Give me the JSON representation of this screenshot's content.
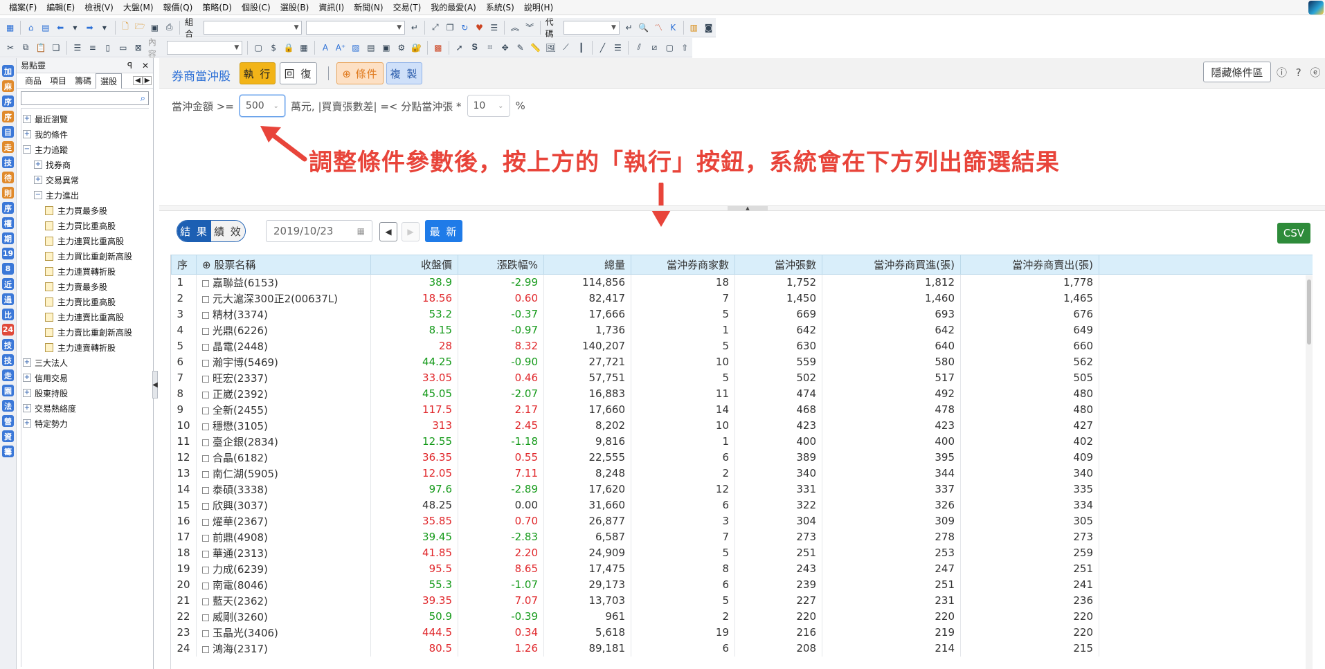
{
  "menu": [
    "檔案(F)",
    "編輯(E)",
    "檢視(V)",
    "大盤(M)",
    "報價(Q)",
    "策略(D)",
    "個股(C)",
    "選股(B)",
    "資訊(I)",
    "新聞(N)",
    "交易(T)",
    "我的最愛(A)",
    "系統(S)",
    "說明(H)"
  ],
  "toolbar": {
    "combo_label": "組合",
    "code_label": "代碼",
    "content_label": "內容"
  },
  "icon_strip": [
    {
      "text": "加",
      "color": "#3b78d8"
    },
    {
      "text": "麻",
      "color": "#e08a2c"
    },
    {
      "text": "序",
      "color": "#3b78d8"
    },
    {
      "text": "序",
      "color": "#e08a2c"
    },
    {
      "text": "目",
      "color": "#3b78d8"
    },
    {
      "text": "走",
      "color": "#e08a2c"
    },
    {
      "text": "技",
      "color": "#3b78d8"
    },
    {
      "text": "待",
      "color": "#e08a2c"
    },
    {
      "text": "則",
      "color": "#e08a2c"
    },
    {
      "text": "序",
      "color": "#3b78d8"
    },
    {
      "text": "權",
      "color": "#3b78d8"
    },
    {
      "text": "期",
      "color": "#3b78d8"
    },
    {
      "text": "19",
      "color": "#3b78d8"
    },
    {
      "text": "8",
      "color": "#3b78d8"
    },
    {
      "text": "近",
      "color": "#3b78d8"
    },
    {
      "text": "過",
      "color": "#3b78d8"
    },
    {
      "text": "比",
      "color": "#3b78d8"
    },
    {
      "text": "24",
      "color": "#e04a3a"
    },
    {
      "text": "技",
      "color": "#3b78d8"
    },
    {
      "text": "技",
      "color": "#3b78d8"
    },
    {
      "text": "走",
      "color": "#3b78d8"
    },
    {
      "text": "園",
      "color": "#3b78d8"
    },
    {
      "text": "法",
      "color": "#3b78d8"
    },
    {
      "text": "營",
      "color": "#3b78d8"
    },
    {
      "text": "資",
      "color": "#3b78d8"
    },
    {
      "text": "籌",
      "color": "#3b78d8"
    }
  ],
  "easy_panel": {
    "title": "易點靈",
    "pin": "ꟼ",
    "close": "✕",
    "tabs": [
      "商品",
      "項目",
      "籌碼",
      "選股"
    ],
    "active_tab": "選股",
    "tree": [
      {
        "label": "最近瀏覽",
        "box": "+",
        "level": 0
      },
      {
        "label": "我的條件",
        "box": "+",
        "level": 0
      },
      {
        "label": "主力追蹤",
        "box": "−",
        "level": 0
      },
      {
        "label": "找券商",
        "box": "+",
        "level": 1
      },
      {
        "label": "交易異常",
        "box": "+",
        "level": 1
      },
      {
        "label": "主力進出",
        "box": "−",
        "level": 1
      },
      {
        "label": "主力買最多股",
        "doc": true,
        "level": 2
      },
      {
        "label": "主力買比重高股",
        "doc": true,
        "level": 2
      },
      {
        "label": "主力連買比重高股",
        "doc": true,
        "level": 2
      },
      {
        "label": "主力買比重創新高股",
        "doc": true,
        "level": 2
      },
      {
        "label": "主力連買轉折股",
        "doc": true,
        "level": 2
      },
      {
        "label": "主力賣最多股",
        "doc": true,
        "level": 2
      },
      {
        "label": "主力賣比重高股",
        "doc": true,
        "level": 2
      },
      {
        "label": "主力連賣比重高股",
        "doc": true,
        "level": 2
      },
      {
        "label": "主力賣比重創新高股",
        "doc": true,
        "level": 2
      },
      {
        "label": "主力連賣轉折股",
        "doc": true,
        "level": 2
      },
      {
        "label": "三大法人",
        "box": "+",
        "level": 0
      },
      {
        "label": "信用交易",
        "box": "+",
        "level": 0
      },
      {
        "label": "股東持股",
        "box": "+",
        "level": 0
      },
      {
        "label": "交易熱絡度",
        "box": "+",
        "level": 0
      },
      {
        "label": "特定勢力",
        "box": "+",
        "level": 0
      }
    ]
  },
  "header": {
    "title": "券商當沖股",
    "run": "執 行",
    "reset": "回 復",
    "condition": "⊕ 條件",
    "copy": "複 製",
    "hide": "隱藏條件區",
    "icons": "ⓘ ⓘ ⓔ"
  },
  "condition": {
    "prefix": "當沖金額 >=",
    "amount": "500",
    "middle": "萬元, |買賣張數差| =< 分點當沖張 *",
    "ratio": "10",
    "suffix": "%"
  },
  "annotation": "調整條件參數後，按上方的「執行」按鈕，系統會在下方列出篩選結果",
  "results": {
    "tab_result": "結 果",
    "tab_perf": "績 效",
    "date": "2019/10/23",
    "latest": "最 新",
    "csv": "CSV"
  },
  "table": {
    "columns": [
      "序",
      "⊕ 股票名稱",
      "收盤價",
      "漲跌幅%",
      "總量",
      "當沖券商家數",
      "當沖張數",
      "當沖券商買進(張)",
      "當沖券商賣出(張)"
    ],
    "rows": [
      {
        "n": "1",
        "name": "嘉聯益(6153)",
        "close": "38.9",
        "chg": "-2.99",
        "vol": "114,856",
        "brokers": "18",
        "dt": "1,752",
        "buy": "1,812",
        "sell": "1,778",
        "dir": "down"
      },
      {
        "n": "2",
        "name": "元大滬深300正2(00637L)",
        "close": "18.56",
        "chg": "0.60",
        "vol": "82,417",
        "brokers": "7",
        "dt": "1,450",
        "buy": "1,460",
        "sell": "1,465",
        "dir": "up"
      },
      {
        "n": "3",
        "name": "精材(3374)",
        "close": "53.2",
        "chg": "-0.37",
        "vol": "17,666",
        "brokers": "5",
        "dt": "669",
        "buy": "693",
        "sell": "676",
        "dir": "down"
      },
      {
        "n": "4",
        "name": "光鼎(6226)",
        "close": "8.15",
        "chg": "-0.97",
        "vol": "1,736",
        "brokers": "1",
        "dt": "642",
        "buy": "642",
        "sell": "649",
        "dir": "down"
      },
      {
        "n": "5",
        "name": "晶電(2448)",
        "close": "28",
        "chg": "8.32",
        "vol": "140,207",
        "brokers": "5",
        "dt": "630",
        "buy": "640",
        "sell": "660",
        "dir": "up"
      },
      {
        "n": "6",
        "name": "瀚宇博(5469)",
        "close": "44.25",
        "chg": "-0.90",
        "vol": "27,721",
        "brokers": "10",
        "dt": "559",
        "buy": "580",
        "sell": "562",
        "dir": "down"
      },
      {
        "n": "7",
        "name": "旺宏(2337)",
        "close": "33.05",
        "chg": "0.46",
        "vol": "57,751",
        "brokers": "5",
        "dt": "502",
        "buy": "517",
        "sell": "505",
        "dir": "up"
      },
      {
        "n": "8",
        "name": "正崴(2392)",
        "close": "45.05",
        "chg": "-2.07",
        "vol": "16,883",
        "brokers": "11",
        "dt": "474",
        "buy": "492",
        "sell": "480",
        "dir": "down"
      },
      {
        "n": "9",
        "name": "全新(2455)",
        "close": "117.5",
        "chg": "2.17",
        "vol": "17,660",
        "brokers": "14",
        "dt": "468",
        "buy": "478",
        "sell": "480",
        "dir": "up"
      },
      {
        "n": "10",
        "name": "穩懋(3105)",
        "close": "313",
        "chg": "2.45",
        "vol": "8,202",
        "brokers": "10",
        "dt": "423",
        "buy": "423",
        "sell": "427",
        "dir": "up"
      },
      {
        "n": "11",
        "name": "臺企銀(2834)",
        "close": "12.55",
        "chg": "-1.18",
        "vol": "9,816",
        "brokers": "1",
        "dt": "400",
        "buy": "400",
        "sell": "402",
        "dir": "down"
      },
      {
        "n": "12",
        "name": "合晶(6182)",
        "close": "36.35",
        "chg": "0.55",
        "vol": "22,555",
        "brokers": "6",
        "dt": "389",
        "buy": "395",
        "sell": "409",
        "dir": "up"
      },
      {
        "n": "13",
        "name": "南仁湖(5905)",
        "close": "12.05",
        "chg": "7.11",
        "vol": "8,248",
        "brokers": "2",
        "dt": "340",
        "buy": "344",
        "sell": "340",
        "dir": "up"
      },
      {
        "n": "14",
        "name": "泰碩(3338)",
        "close": "97.6",
        "chg": "-2.89",
        "vol": "17,620",
        "brokers": "12",
        "dt": "331",
        "buy": "337",
        "sell": "335",
        "dir": "down"
      },
      {
        "n": "15",
        "name": "欣興(3037)",
        "close": "48.25",
        "chg": "0.00",
        "vol": "31,660",
        "brokers": "6",
        "dt": "322",
        "buy": "326",
        "sell": "334",
        "dir": "flat"
      },
      {
        "n": "16",
        "name": "燿華(2367)",
        "close": "35.85",
        "chg": "0.70",
        "vol": "26,877",
        "brokers": "3",
        "dt": "304",
        "buy": "309",
        "sell": "305",
        "dir": "up"
      },
      {
        "n": "17",
        "name": "前鼎(4908)",
        "close": "39.45",
        "chg": "-2.83",
        "vol": "6,587",
        "brokers": "7",
        "dt": "273",
        "buy": "278",
        "sell": "273",
        "dir": "down"
      },
      {
        "n": "18",
        "name": "華通(2313)",
        "close": "41.85",
        "chg": "2.20",
        "vol": "24,909",
        "brokers": "5",
        "dt": "251",
        "buy": "253",
        "sell": "259",
        "dir": "up"
      },
      {
        "n": "19",
        "name": "力成(6239)",
        "close": "95.5",
        "chg": "8.65",
        "vol": "17,475",
        "brokers": "8",
        "dt": "243",
        "buy": "247",
        "sell": "251",
        "dir": "up"
      },
      {
        "n": "20",
        "name": "南電(8046)",
        "close": "55.3",
        "chg": "-1.07",
        "vol": "29,173",
        "brokers": "6",
        "dt": "239",
        "buy": "251",
        "sell": "241",
        "dir": "down"
      },
      {
        "n": "21",
        "name": "藍天(2362)",
        "close": "39.35",
        "chg": "7.07",
        "vol": "13,703",
        "brokers": "5",
        "dt": "227",
        "buy": "231",
        "sell": "236",
        "dir": "up"
      },
      {
        "n": "22",
        "name": "威剛(3260)",
        "close": "50.9",
        "chg": "-0.39",
        "vol": "961",
        "brokers": "2",
        "dt": "220",
        "buy": "220",
        "sell": "220",
        "dir": "down"
      },
      {
        "n": "23",
        "name": "玉晶光(3406)",
        "close": "444.5",
        "chg": "0.34",
        "vol": "5,618",
        "brokers": "19",
        "dt": "216",
        "buy": "219",
        "sell": "220",
        "dir": "up"
      },
      {
        "n": "24",
        "name": "鴻海(2317)",
        "close": "80.5",
        "chg": "1.26",
        "vol": "89,181",
        "brokers": "6",
        "dt": "208",
        "buy": "214",
        "sell": "215",
        "dir": "up"
      }
    ]
  }
}
